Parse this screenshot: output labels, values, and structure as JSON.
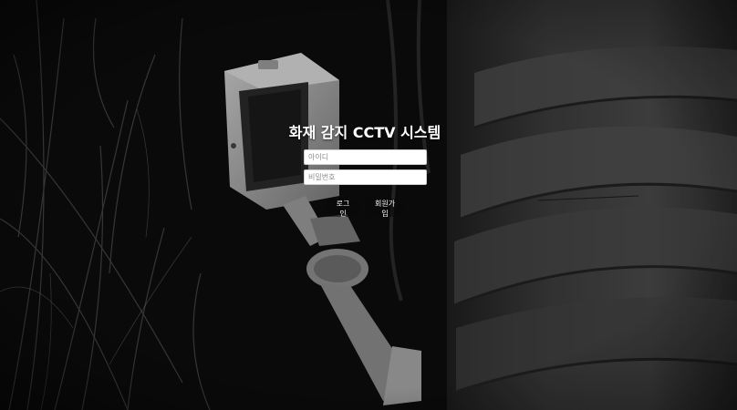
{
  "app": {
    "title": "화재 감지 CCTV 시스템"
  },
  "login_form": {
    "id_field": {
      "value": "",
      "placeholder": "아이디"
    },
    "password_field": {
      "value": "",
      "placeholder": "비밀번호"
    },
    "login_button": "로그인",
    "signup_button": "회원가입"
  },
  "background": {
    "subject": "cctv-camera-photo",
    "tone": "grayscale"
  },
  "colors": {
    "title_text": "#ffffff",
    "button_text": "#ffffff",
    "input_background": "#ffffff",
    "placeholder_text": "#8a8a8a"
  }
}
